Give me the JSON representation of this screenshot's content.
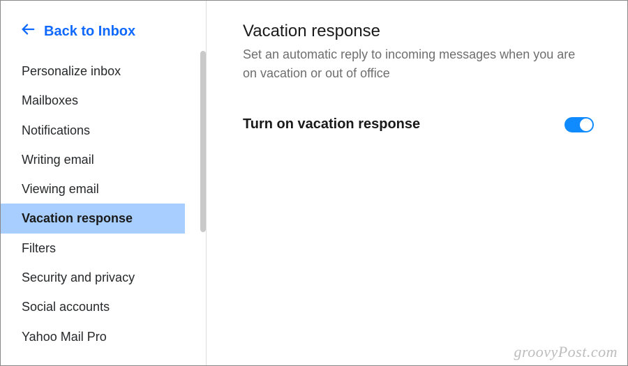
{
  "sidebar": {
    "back_label": "Back to Inbox",
    "items": [
      {
        "label": "Personalize inbox",
        "active": false
      },
      {
        "label": "Mailboxes",
        "active": false
      },
      {
        "label": "Notifications",
        "active": false
      },
      {
        "label": "Writing email",
        "active": false
      },
      {
        "label": "Viewing email",
        "active": false
      },
      {
        "label": "Vacation response",
        "active": true
      },
      {
        "label": "Filters",
        "active": false
      },
      {
        "label": "Security and privacy",
        "active": false
      },
      {
        "label": "Social accounts",
        "active": false
      },
      {
        "label": "Yahoo Mail Pro",
        "active": false
      }
    ]
  },
  "main": {
    "title": "Vacation response",
    "description": "Set an automatic reply to incoming messages when you are on vacation or out of office",
    "toggle_label": "Turn on vacation response",
    "toggle_on": true
  },
  "watermark": "groovyPost.com"
}
